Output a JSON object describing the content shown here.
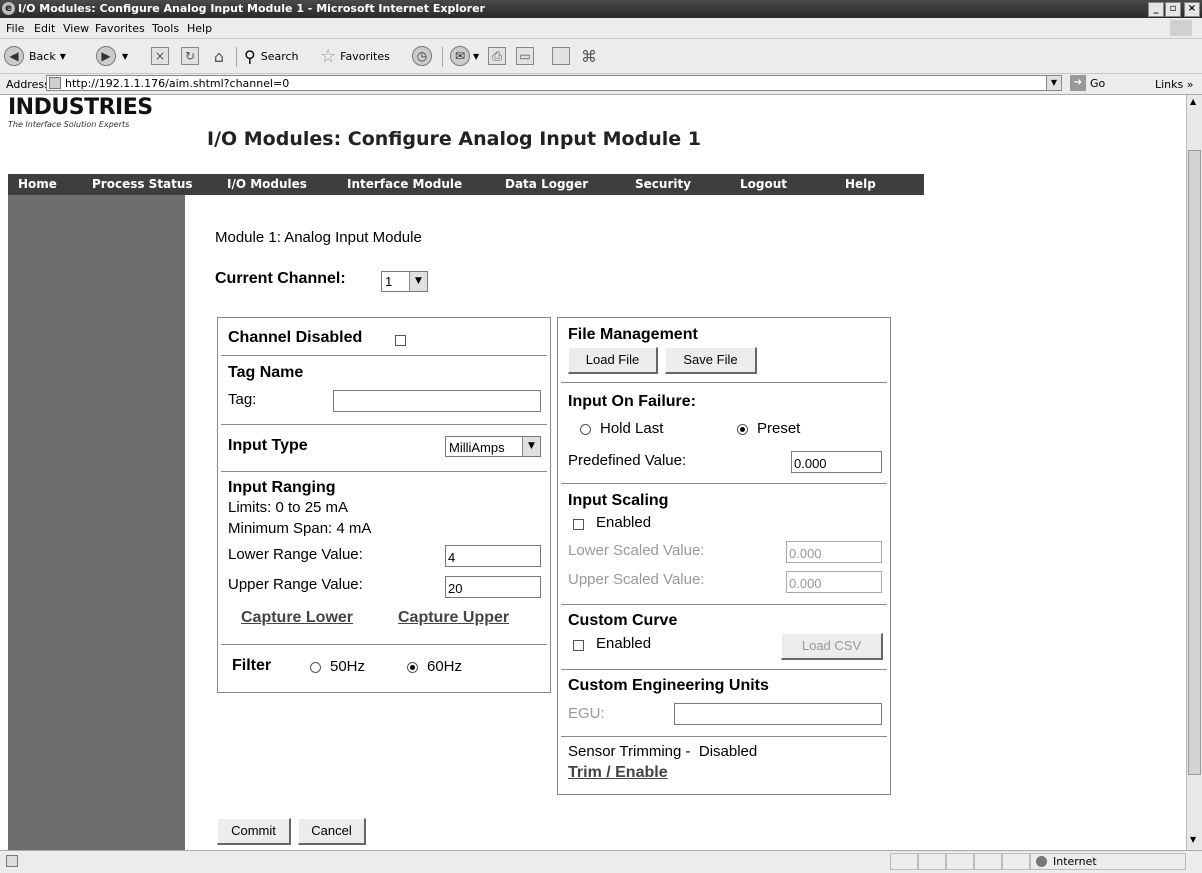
{
  "window": {
    "title": "I/O Modules: Configure Analog Input Module 1 - Microsoft Internet Explorer"
  },
  "menu": [
    "File",
    "Edit",
    "View",
    "Favorites",
    "Tools",
    "Help"
  ],
  "toolbar": {
    "back": "Back",
    "search": "Search",
    "favorites": "Favorites"
  },
  "address": {
    "label": "Address",
    "url": "http://192.1.1.176/aim.shtml?channel=0",
    "go": "Go",
    "links": "Links"
  },
  "logo": {
    "name": "INDUSTRIES",
    "tagline": "The Interface Solution Experts"
  },
  "page": {
    "title": "I/O Modules: Configure Analog Input Module 1"
  },
  "nav": [
    "Home",
    "Process Status",
    "I/O Modules",
    "Interface Module",
    "Data Logger",
    "Security",
    "Logout",
    "Help"
  ],
  "module": {
    "heading": "Module 1: Analog Input Module",
    "current_channel_label": "Current Channel:",
    "current_channel_value": "1"
  },
  "left_panel": {
    "channel_disabled": "Channel Disabled",
    "tag_name": "Tag Name",
    "tag_label": "Tag:",
    "tag_value": "",
    "input_type": "Input Type",
    "input_type_value": "MilliAmps",
    "input_ranging": "Input Ranging",
    "limits": "Limits: 0 to 25 mA",
    "min_span": "Minimum Span: 4 mA",
    "lower_range_label": "Lower Range Value:",
    "lower_range_value": "4",
    "upper_range_label": "Upper Range Value:",
    "upper_range_value": "20",
    "capture_lower": "Capture Lower",
    "capture_upper": "Capture Upper",
    "filter": "Filter",
    "filter_50": "50Hz",
    "filter_60": "60Hz"
  },
  "right_panel": {
    "file_management": "File Management",
    "load_file": "Load File",
    "save_file": "Save File",
    "input_on_failure": "Input On Failure:",
    "hold_last": "Hold Last",
    "preset": "Preset",
    "predefined_label": "Predefined Value:",
    "predefined_value": "0.000",
    "input_scaling": "Input Scaling",
    "scaling_enabled": "Enabled",
    "lower_scaled_label": "Lower Scaled Value:",
    "lower_scaled_value": "0.000",
    "upper_scaled_label": "Upper Scaled Value:",
    "upper_scaled_value": "0.000",
    "custom_curve": "Custom Curve",
    "curve_enabled": "Enabled",
    "load_csv": "Load CSV",
    "custom_eng_units": "Custom Engineering Units",
    "egu_label": "EGU:",
    "egu_value": "",
    "sensor_trimming": "Sensor Trimming -  Disabled",
    "trim_enable": "Trim / Enable"
  },
  "actions": {
    "commit": "Commit",
    "cancel": "Cancel"
  },
  "status": {
    "zone": "Internet"
  }
}
